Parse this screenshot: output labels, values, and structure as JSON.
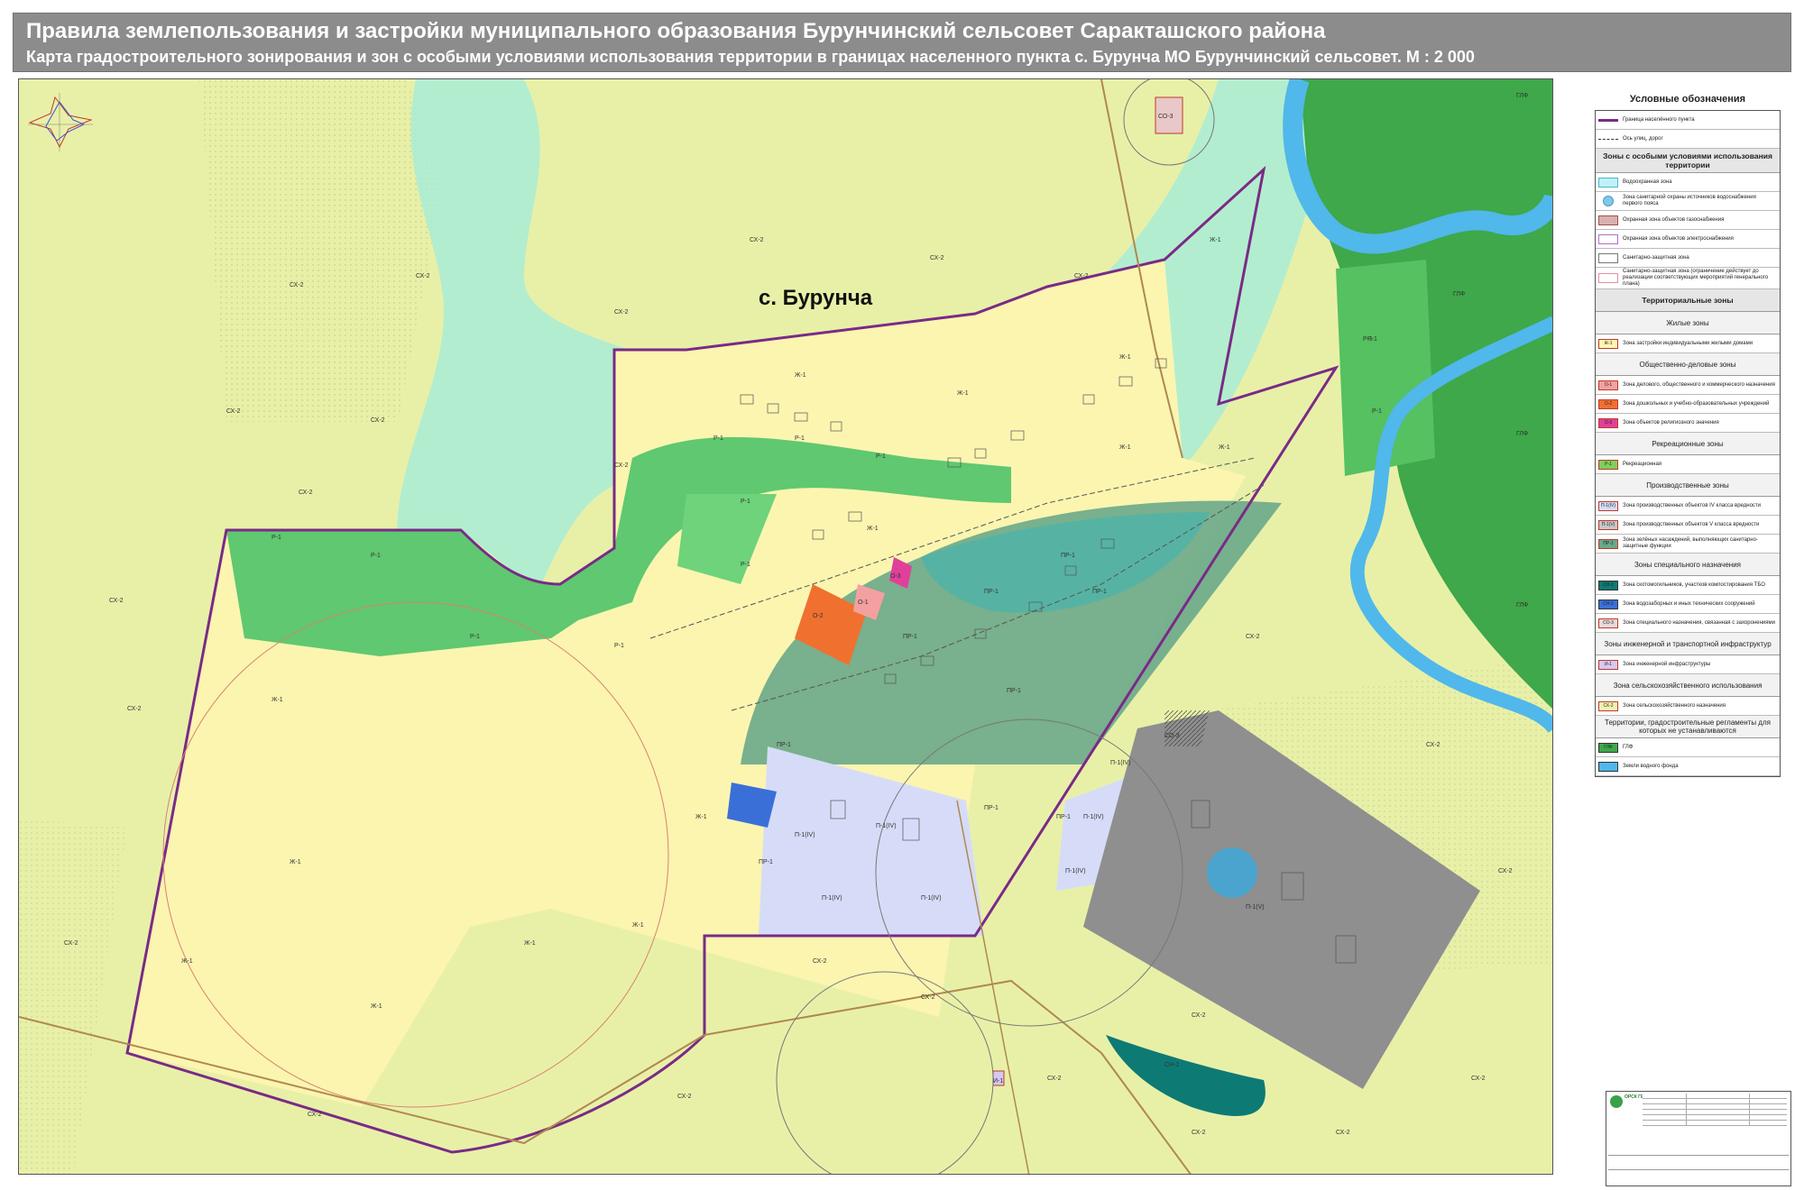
{
  "header": {
    "title": "Правила землепользования и застройки  муниципального образования Бурунчинский сельсовет Саракташского района",
    "subtitle": "Карта градостроительного зонирования и зон с особыми условиями использования территории в границах населенного пункта с. Бурунча  МО Бурунчинский сельсовет. М : 2 000"
  },
  "map": {
    "settlement": "с. Бурунча",
    "labels": {
      "sx2": "СХ-2",
      "zh1": "Ж-1",
      "r1": "Р-1",
      "o1": "О-1",
      "o2": "О-2",
      "o3": "О-3",
      "pp1": "ПР-1",
      "p1iv": "П-1(IV)",
      "p1v": "П-1(V)",
      "so3": "СО-3",
      "gf": "ГЛФ",
      "sn": "СН-1",
      "i1": "И-1"
    }
  },
  "legend": {
    "title": "Условные обозначения",
    "items": [
      {
        "kind": "line",
        "color": "#7a2a87",
        "text": "Граница населённого пункта"
      },
      {
        "kind": "dash",
        "color": "#333333",
        "text": "Ось улиц, дорог"
      },
      {
        "kind": "head",
        "text": "Зоны с особыми условиями использования территории",
        "big": true
      },
      {
        "kind": "sw",
        "fill": "#bff2f7",
        "border": "#4bb6c9",
        "code": "",
        "text": "Водоохранная зона"
      },
      {
        "kind": "circle",
        "fill": "#7ec8e8",
        "code": "",
        "text": "Зона санитарной охраны источников водоснабжения первого пояса"
      },
      {
        "kind": "sw",
        "fill": "#d9b0b0",
        "border": "#a05050",
        "code": "",
        "text": "Охранная зона объектов газоснабжения"
      },
      {
        "kind": "sw",
        "fill": "#ffffff",
        "border": "#b070c0",
        "code": "",
        "text": "Охранная зона объектов электроснабжения"
      },
      {
        "kind": "sw",
        "fill": "#ffffff",
        "border": "#777777",
        "code": "",
        "text": "Санитарно-защитная зона"
      },
      {
        "kind": "sw",
        "fill": "#ffffff",
        "border": "#e090a0",
        "code": "",
        "text": "Санитарно-защитная зона (ограничение действует до реализации соответствующих мероприятий генерального плана)"
      },
      {
        "kind": "head",
        "text": "Территориальные зоны",
        "big": true
      },
      {
        "kind": "head",
        "text": "Жилые зоны"
      },
      {
        "kind": "sw",
        "fill": "#fdf6b0",
        "border": "#c0392b",
        "code": "Ж-1",
        "text": "Зона застройки индивидуальными жилыми домами"
      },
      {
        "kind": "head",
        "text": "Общественно-деловые зоны"
      },
      {
        "kind": "sw",
        "fill": "#f4a0a0",
        "border": "#c0392b",
        "code": "О-1",
        "text": "Зона делового, общественного и коммерческого назначения"
      },
      {
        "kind": "sw",
        "fill": "#f07030",
        "border": "#c0392b",
        "code": "О-2",
        "text": "Зона дошкольных и учебно-образовательных учреждений"
      },
      {
        "kind": "sw",
        "fill": "#e0409a",
        "border": "#c0392b",
        "code": "О-3",
        "text": "Зона объектов религиозного значения"
      },
      {
        "kind": "head",
        "text": "Рекреационные зоны"
      },
      {
        "kind": "sw",
        "fill": "#7ecf5a",
        "border": "#c0392b",
        "code": "Р-1",
        "text": "Рекреационная"
      },
      {
        "kind": "head",
        "text": "Производственные зоны"
      },
      {
        "kind": "sw",
        "fill": "#d6dcf7",
        "border": "#c0392b",
        "code": "П-1(IV)",
        "text": "Зона производственных объектов  IV класса вредности"
      },
      {
        "kind": "sw",
        "fill": "#c7c7c7",
        "border": "#c0392b",
        "code": "П-1(V)",
        "text": "Зона производственных объектов  V класса вредности"
      },
      {
        "kind": "sw",
        "fill": "#6aa98a",
        "border": "#c0392b",
        "code": "ПР-1",
        "text": "Зона зелёных насаждений, выполняющих санитарно-защитные функции"
      },
      {
        "kind": "head",
        "text": "Зоны специального  назначения"
      },
      {
        "kind": "sw",
        "fill": "#0e7a74",
        "border": "#333333",
        "code": "СН-1",
        "text": "Зона скотомогильников, участков компостирования ТБО"
      },
      {
        "kind": "sw",
        "fill": "#3a6fd8",
        "border": "#333333",
        "code": "СН-2",
        "text": "Зона водозаборных и иных технических сооружений"
      },
      {
        "kind": "sw",
        "fill": "#e8d8d8",
        "border": "#c0392b",
        "code": "СО-3",
        "text": "Зона специального назначения, связанная с захоронениями"
      },
      {
        "kind": "head",
        "text": "Зоны инженерной и транспортной инфраструктур"
      },
      {
        "kind": "sw",
        "fill": "#d6c8f0",
        "border": "#c0392b",
        "code": "И-1",
        "text": "Зона инженерной инфраструктуры"
      },
      {
        "kind": "head",
        "text": "Зона сельскохозяйственного использования"
      },
      {
        "kind": "sw",
        "fill": "#f2f2b0",
        "border": "#c0392b",
        "code": "СХ-2",
        "text": "Зона  сельскохозяйственного назначения"
      },
      {
        "kind": "head",
        "text": "Территории, градостроительные регламенты для которых не устанавливаются"
      },
      {
        "kind": "sw",
        "fill": "#3ea84a",
        "border": "#333333",
        "code": "ГЛФ",
        "text": "ГЛФ"
      },
      {
        "kind": "sw",
        "fill": "#50b8ea",
        "border": "#333333",
        "code": "",
        "text": "Земли водного фонда"
      }
    ]
  },
  "stamp": {
    "org": "ОРСК ГЕОКАД"
  },
  "colors": {
    "header_bg": "#8c8c8c",
    "boundary": "#7a2a87",
    "sx2": "#e8f0a8",
    "zh1": "#fbf5b0",
    "r1": "#5fc870",
    "river": "#50b8ea",
    "forest": "#3ea84a"
  }
}
